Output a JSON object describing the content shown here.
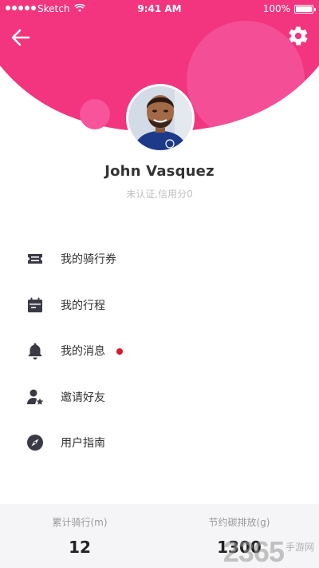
{
  "status_bar": {
    "carrier": "Sketch",
    "time": "9:41 AM",
    "battery": "100%"
  },
  "header": {
    "back_icon": "arrow-left-icon",
    "settings_icon": "gear-icon",
    "accent_color": "#f2357e"
  },
  "profile": {
    "name": "John Vasquez",
    "credit_status": "未认证,信用分0"
  },
  "menu": {
    "items": [
      {
        "label": "我的骑行券",
        "icon": "ticket-icon"
      },
      {
        "label": "我的行程",
        "icon": "calendar-icon"
      },
      {
        "label": "我的消息",
        "icon": "bell-icon",
        "has_unread": true
      },
      {
        "label": "邀请好友",
        "icon": "user-star-icon"
      },
      {
        "label": "用户指南",
        "icon": "compass-icon"
      }
    ]
  },
  "stats": {
    "ride_total": {
      "label": "累计骑行(m)",
      "value": "12"
    },
    "carbon_saved": {
      "label": "节约碳排放(g)",
      "value": "1300"
    }
  },
  "watermark": {
    "number": "2365",
    "text": "手游网"
  }
}
